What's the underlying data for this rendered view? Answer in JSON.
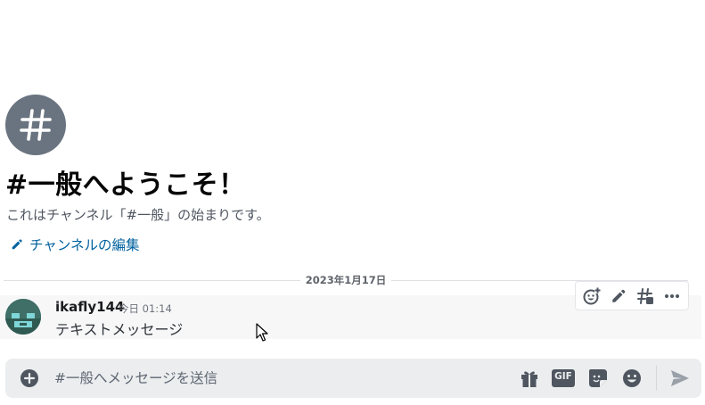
{
  "channel": {
    "avatar_symbol": "#",
    "welcome_title": "#一般へようこそ！",
    "welcome_description": "これはチャンネル「#一般」の始まりです。",
    "edit_link_label": "チャンネルの編集"
  },
  "date_divider": "2023年1月17日",
  "message": {
    "author": "ikafly144",
    "timestamp": "今日 01:14",
    "text": "テキストメッセージ"
  },
  "message_toolbar": {
    "buttons": [
      "add-reaction-icon",
      "edit-icon",
      "create-thread-icon",
      "more-icon"
    ]
  },
  "composer": {
    "placeholder": "#一般へメッセージを送信",
    "value": "",
    "gif_label": "GIF",
    "buttons": [
      "gift-icon",
      "gif-icon",
      "sticker-icon",
      "emoji-icon",
      "send-icon"
    ]
  },
  "colors": {
    "link": "#00629f",
    "channel_avatar_bg": "#6a7480",
    "composer_bg": "#ebedef",
    "message_hover_bg": "#f7f7f8"
  }
}
